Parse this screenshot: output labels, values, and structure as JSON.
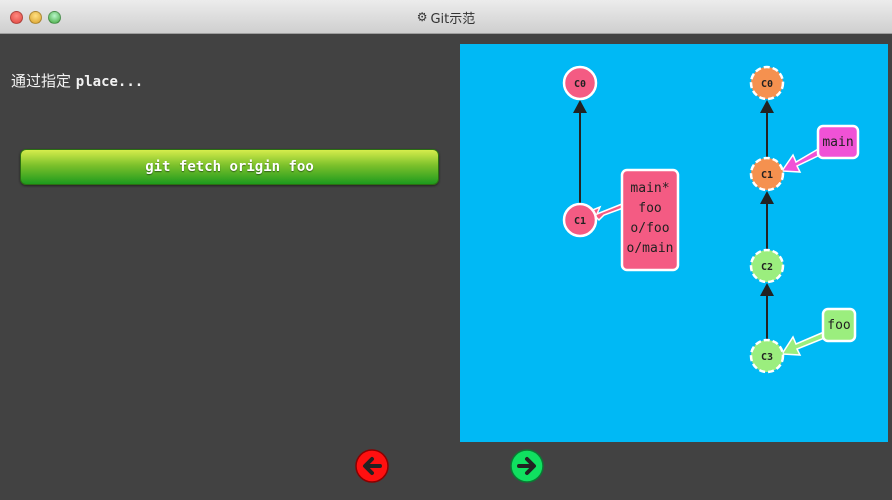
{
  "window": {
    "title": "Git示范",
    "icon": "gear-icon"
  },
  "instruction": {
    "prefix": "通过指定 ",
    "code": "place..."
  },
  "command": {
    "label": "git fetch origin foo"
  },
  "graph": {
    "local": {
      "commits": [
        {
          "id": "C0",
          "label": "C0"
        },
        {
          "id": "C1",
          "label": "C1"
        }
      ],
      "branch_box": [
        "main*",
        "foo",
        "o/foo",
        "o/main"
      ]
    },
    "remote": {
      "commits": [
        {
          "id": "C0",
          "label": "C0"
        },
        {
          "id": "C1",
          "label": "C1"
        },
        {
          "id": "C2",
          "label": "C2"
        },
        {
          "id": "C3",
          "label": "C3"
        }
      ],
      "branches": [
        {
          "name": "main",
          "label": "main"
        },
        {
          "name": "foo",
          "label": "foo"
        }
      ]
    }
  },
  "nav": {
    "back_icon": "arrow-left-icon",
    "forward_icon": "arrow-right-icon"
  },
  "colors": {
    "canvas": "#00b9f5",
    "local_commit": "#f45b83",
    "remote_main_commit": "#f5914f",
    "remote_foo_commit": "#9bee7e",
    "main_branch": "#f052d6",
    "foo_branch": "#9bee7e",
    "back": "#ff1010",
    "forward": "#10e060"
  }
}
